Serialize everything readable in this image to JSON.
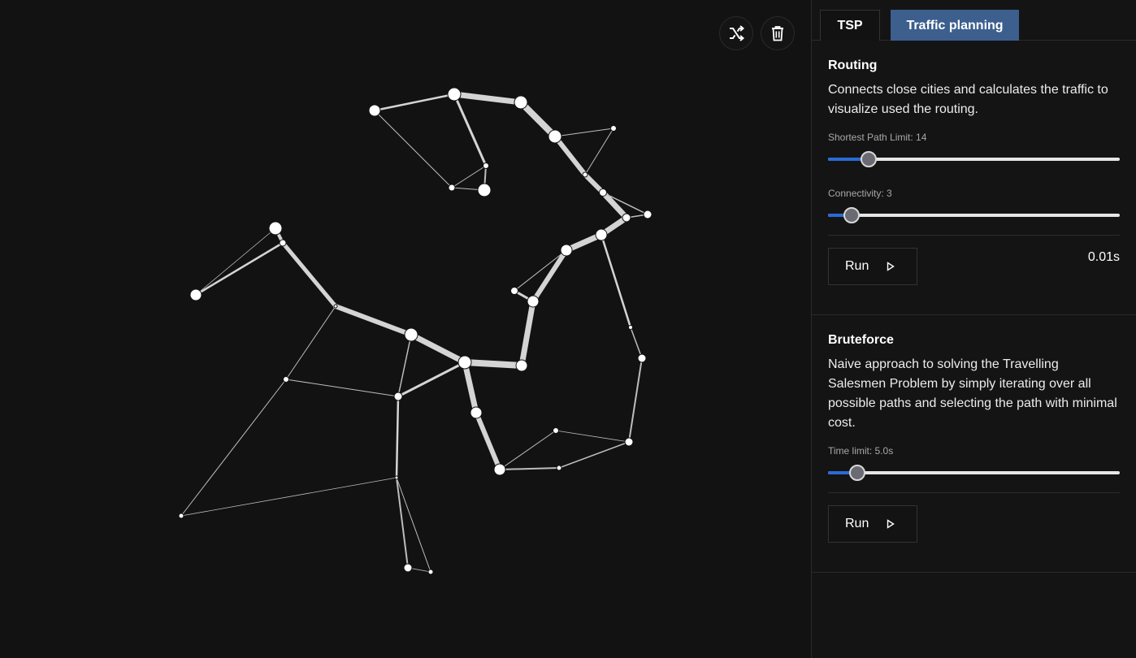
{
  "toolbar": {
    "shuffle_icon": "shuffle-icon",
    "delete_icon": "trash-icon"
  },
  "tabs": [
    {
      "label": "TSP",
      "active": false
    },
    {
      "label": "Traffic planning",
      "active": true
    }
  ],
  "routing": {
    "title": "Routing",
    "description": "Connects close cities and calculates the traffic to visualize used the routing.",
    "shortest_path_label": "Shortest Path Limit: 14",
    "shortest_path_value": 0.14,
    "connectivity_label": "Connectivity: 3",
    "connectivity_value": 0.08,
    "run_label": "Run",
    "timing": "0.01s"
  },
  "bruteforce": {
    "title": "Bruteforce",
    "description": "Naive approach to solving the Travelling Salesmen Problem by simply iterating over all possible paths and selecting the path with minimal cost.",
    "time_limit_label": "Time limit: 5.0s",
    "time_limit_value": 0.1,
    "run_label": "Run"
  },
  "colors": {
    "accent": "#2a6ad8",
    "active_tab": "#3c5f8e",
    "background": "#121212"
  }
}
